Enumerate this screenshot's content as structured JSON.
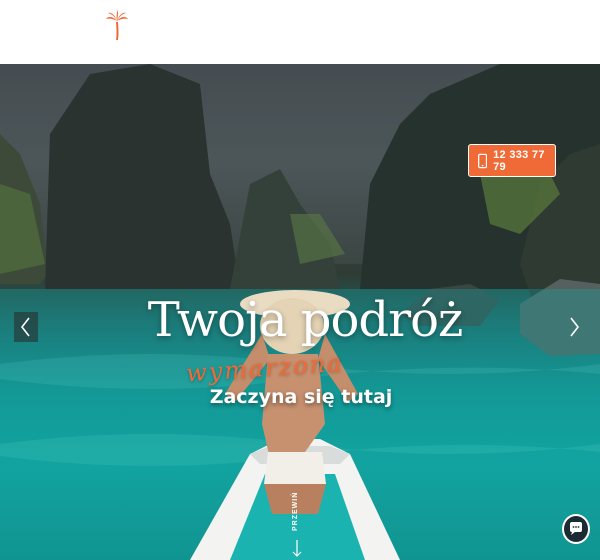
{
  "header": {
    "logo_icon": "palm-tree-icon"
  },
  "hero": {
    "phone": {
      "label": "12 333 77 79",
      "icon": "phone-icon"
    },
    "title": "Twoja podróż",
    "script_word": "wymarzona",
    "subtitle": "Zaczyna się tutaj",
    "scroll_label": "PRZEWIŃ",
    "prev_icon": "chevron-left-icon",
    "next_icon": "chevron-right-icon",
    "scroll_icon": "arrow-down-icon",
    "chat_icon": "chat-bubble-icon"
  },
  "colors": {
    "accent": "#ef6a37",
    "water": "#12a4a0",
    "sky": "#4b5558"
  }
}
